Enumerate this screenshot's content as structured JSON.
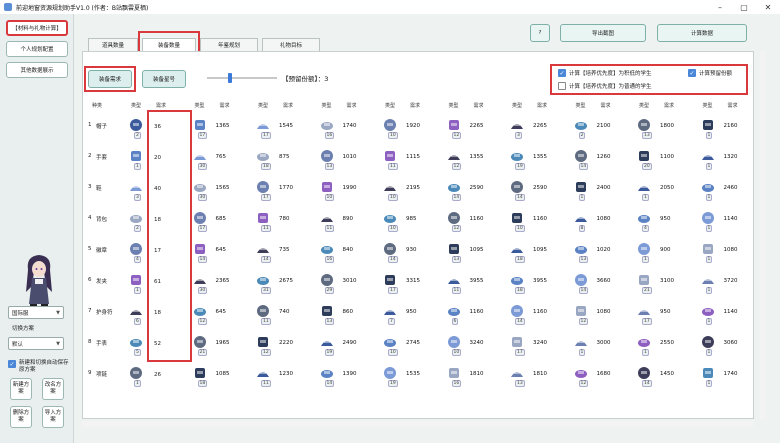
{
  "window": {
    "title": "前迎地窗资源规划助手V1.0 (作者：B站飘雲夏栖)"
  },
  "sidebar": {
    "buttons": [
      "【材料与礼物计算】",
      "个人规划配置",
      "其他数据展示"
    ],
    "server": "国际服",
    "switch_label": "切换方案",
    "plan": "默认",
    "auto_save": "新建和切换自动保存原方案",
    "actions": [
      "新建方案",
      "改名方案",
      "删除方案",
      "导入方案"
    ]
  },
  "tabs": [
    "道具数量",
    "装备数量",
    "年鉴规划",
    "礼物目标"
  ],
  "toolbar": {
    "help": "?",
    "export": "导出截图",
    "calc": "计算数据"
  },
  "mode_buttons": [
    "装备需求",
    "装备星号"
  ],
  "quota": {
    "label": "【预留份额】：",
    "value": "3"
  },
  "options": {
    "opt1": "计算【培养优先度】为积低的学生",
    "opt2": "计算【培养优先度】为普通的学生",
    "opt3": "计算预留份额"
  },
  "headers": [
    "种类",
    "类型",
    "需求"
  ],
  "rows": [
    {
      "idx": "1",
      "name": "帽子",
      "need": "36",
      "values": [
        "1365",
        "1545",
        "1740",
        "1920",
        "2265",
        "2265",
        "2100",
        "1800",
        "2160"
      ],
      "counts": [
        "2",
        "17",
        "17",
        "16",
        "10",
        "12",
        "3",
        "2",
        "13",
        "1"
      ]
    },
    {
      "idx": "2",
      "name": "手套",
      "need": "20",
      "values": [
        "765",
        "875",
        "1010",
        "1115",
        "1355",
        "1355",
        "1260",
        "1100",
        "1320"
      ],
      "counts": [
        "1",
        "30",
        "18",
        "13",
        "11",
        "12",
        "19",
        "14",
        "20",
        "1"
      ]
    },
    {
      "idx": "3",
      "name": "鞋",
      "need": "40",
      "values": [
        "1565",
        "1770",
        "1990",
        "2195",
        "2590",
        "2590",
        "2400",
        "2050",
        "2460"
      ],
      "counts": [
        "3",
        "30",
        "17",
        "10",
        "10",
        "14",
        "14",
        "1",
        "1",
        "1"
      ]
    },
    {
      "idx": "4",
      "name": "背包",
      "need": "18",
      "values": [
        "685",
        "780",
        "890",
        "985",
        "1160",
        "1160",
        "1080",
        "950",
        "1140"
      ],
      "counts": [
        "2",
        "17",
        "11",
        "11",
        "10",
        "12",
        "10",
        "8",
        "4",
        "1"
      ]
    },
    {
      "idx": "5",
      "name": "徽章",
      "need": "17",
      "values": [
        "645",
        "735",
        "840",
        "930",
        "1095",
        "1095",
        "1020",
        "900",
        "1080"
      ],
      "counts": [
        "4",
        "14",
        "14",
        "16",
        "14",
        "13",
        "18",
        "13",
        "1",
        "1"
      ]
    },
    {
      "idx": "6",
      "name": "发夹",
      "need": "61",
      "values": [
        "2365",
        "2675",
        "3010",
        "3315",
        "3955",
        "3955",
        "3660",
        "3100",
        "3720"
      ],
      "counts": [
        "1",
        "30",
        "31",
        "29",
        "17",
        "11",
        "18",
        "14",
        "21",
        "1"
      ]
    },
    {
      "idx": "7",
      "name": "护身符",
      "need": "18",
      "values": [
        "645",
        "740",
        "860",
        "950",
        "1160",
        "1160",
        "1080",
        "950",
        "1140"
      ],
      "counts": [
        "6",
        "12",
        "11",
        "13",
        "7",
        "6",
        "14",
        "12",
        "17",
        "1"
      ]
    },
    {
      "idx": "8",
      "name": "手表",
      "need": "52",
      "values": [
        "1965",
        "2220",
        "2490",
        "2745",
        "3240",
        "3240",
        "3000",
        "2550",
        "3060"
      ],
      "counts": [
        "5",
        "21",
        "12",
        "19",
        "10",
        "10",
        "17",
        "1",
        "1",
        "1"
      ]
    },
    {
      "idx": "9",
      "name": "项链",
      "need": "26",
      "values": [
        "1085",
        "1230",
        "1390",
        "1535",
        "1810",
        "1810",
        "1680",
        "1450",
        "1740"
      ],
      "counts": [
        "1",
        "18",
        "11",
        "14",
        "19",
        "16",
        "13",
        "12",
        "14",
        "1"
      ]
    }
  ],
  "colors": {
    "accent": "#d9383c",
    "check": "#4b87d8",
    "panel": "#ffffff"
  }
}
